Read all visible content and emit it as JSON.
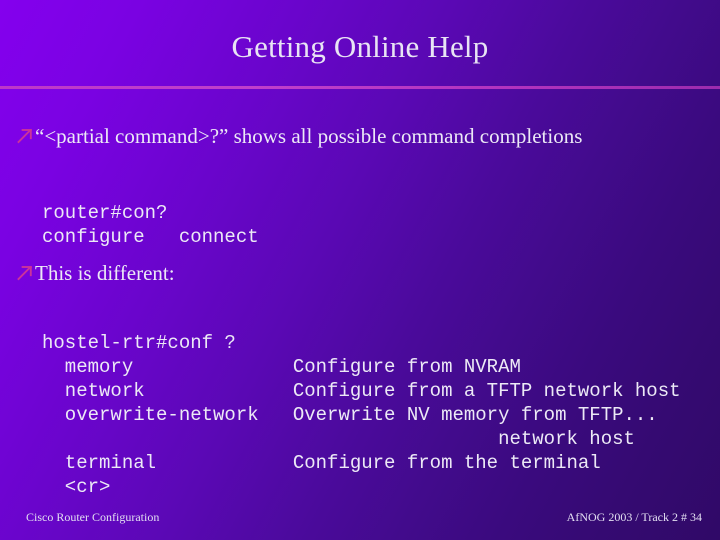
{
  "slide": {
    "title": "Getting Online Help",
    "background_start_color": "#8400ee",
    "background_end_color": "#300967",
    "divider_color": "#bd38c8",
    "text_color": "#ece9f6",
    "bullet_color": "#cc3399",
    "bullet_icon": "arrow-up-right-icon"
  },
  "bullets": [
    {
      "label": "“<partial command>?” shows all possible command completions"
    },
    {
      "label": "This is different:"
    }
  ],
  "code_blocks": [
    {
      "name": "partial-command-example",
      "text": "router#con?\nconfigure   connect"
    },
    {
      "name": "conf-help-example",
      "text": "hostel-rtr#conf ?\n  memory              Configure from NVRAM\n  network             Configure from a TFTP network host\n  overwrite-network   Overwrite NV memory from TFTP...\n                                        network host\n  terminal            Configure from the terminal\n  <cr>"
    }
  ],
  "footer": {
    "left": "Cisco Router Configuration",
    "right": "AfNOG 2003 / Track 2  # 34"
  }
}
